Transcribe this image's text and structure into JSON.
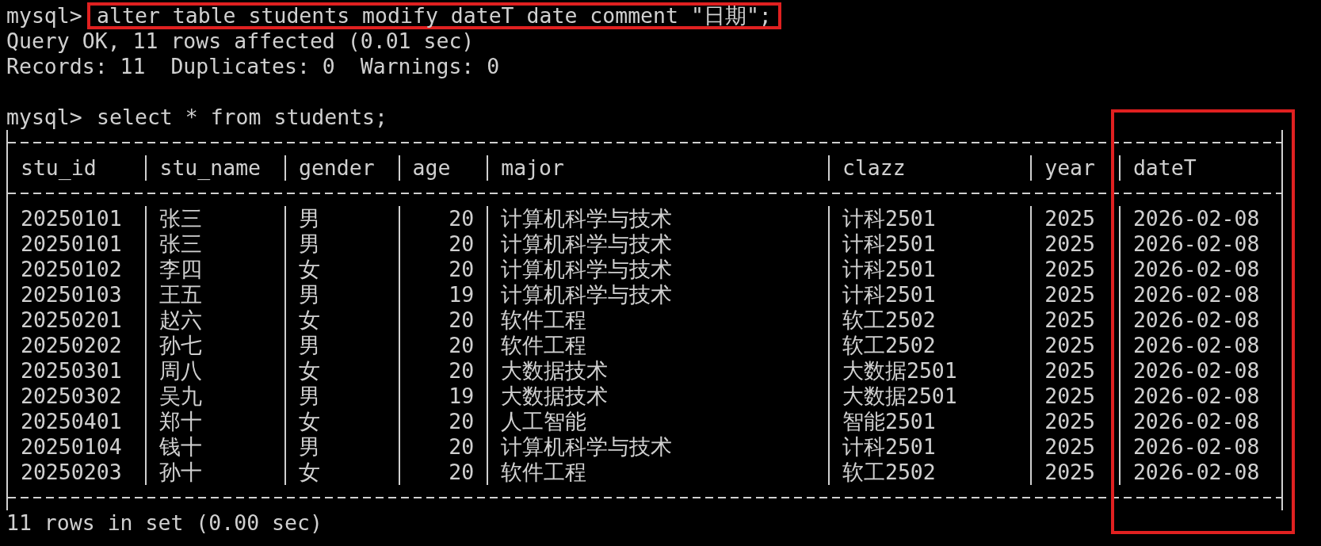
{
  "command_1": {
    "prompt": "mysql>",
    "text": "alter table students modify dateT date comment \"日期\";",
    "highlighted": true
  },
  "output_1": [
    "Query OK, 11 rows affected (0.01 sec)",
    "Records: 11  Duplicates: 0  Warnings: 0"
  ],
  "command_2": {
    "prompt": "mysql>",
    "text": "select * from students;",
    "highlighted": false
  },
  "table": {
    "columns": [
      {
        "name": "stu_id",
        "kind": "text",
        "highlighted": false
      },
      {
        "name": "stu_name",
        "kind": "text",
        "highlighted": false
      },
      {
        "name": "gender",
        "kind": "text",
        "highlighted": false
      },
      {
        "name": "age",
        "kind": "number",
        "highlighted": false
      },
      {
        "name": "major",
        "kind": "text",
        "highlighted": false
      },
      {
        "name": "clazz",
        "kind": "text",
        "highlighted": false
      },
      {
        "name": "year",
        "kind": "text",
        "highlighted": false
      },
      {
        "name": "dateT",
        "kind": "text",
        "highlighted": true
      }
    ],
    "rows": [
      [
        "20250101",
        "张三",
        "男",
        "20",
        "计算机科学与技术",
        "计科2501",
        "2025",
        "2026-02-08"
      ],
      [
        "20250101",
        "张三",
        "男",
        "20",
        "计算机科学与技术",
        "计科2501",
        "2025",
        "2026-02-08"
      ],
      [
        "20250102",
        "李四",
        "女",
        "20",
        "计算机科学与技术",
        "计科2501",
        "2025",
        "2026-02-08"
      ],
      [
        "20250103",
        "王五",
        "男",
        "19",
        "计算机科学与技术",
        "计科2501",
        "2025",
        "2026-02-08"
      ],
      [
        "20250201",
        "赵六",
        "女",
        "20",
        "软件工程",
        "软工2502",
        "2025",
        "2026-02-08"
      ],
      [
        "20250202",
        "孙七",
        "男",
        "20",
        "软件工程",
        "软工2502",
        "2025",
        "2026-02-08"
      ],
      [
        "20250301",
        "周八",
        "女",
        "20",
        "大数据技术",
        "大数据2501",
        "2025",
        "2026-02-08"
      ],
      [
        "20250302",
        "吴九",
        "男",
        "19",
        "大数据技术",
        "大数据2501",
        "2025",
        "2026-02-08"
      ],
      [
        "20250401",
        "郑十",
        "女",
        "20",
        "人工智能",
        "智能2501",
        "2025",
        "2026-02-08"
      ],
      [
        "20250104",
        "钱十",
        "男",
        "20",
        "计算机科学与技术",
        "计科2501",
        "2025",
        "2026-02-08"
      ],
      [
        "20250203",
        "孙十",
        "女",
        "20",
        "软件工程",
        "软工2502",
        "2025",
        "2026-02-08"
      ]
    ]
  },
  "footer": "11 rows in set (0.00 sec)"
}
